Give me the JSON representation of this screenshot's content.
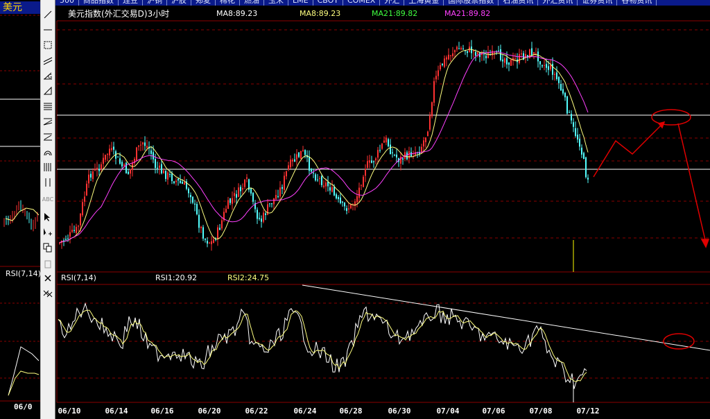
{
  "topnav": {
    "tabs": [
      "500",
      "商品指数",
      "连豆",
      "沪铜",
      "沪胶",
      "郑麦",
      "棉花",
      "燃油",
      "玉米",
      "LME",
      "CBOT",
      "COMEX",
      "外汇",
      "上海黄金",
      "国际股票指数",
      "石油资讯",
      "外汇资讯",
      "证券资讯",
      "谷物资讯"
    ]
  },
  "left_panel": {
    "title": "美元",
    "rsi_label": "RSI(7,14)",
    "date_label": "06/0"
  },
  "chart": {
    "title": "美元指数(外汇交易D)3小时",
    "ma8a": "MA8:89.23",
    "ma8b": "MA8:89.23",
    "ma21a": "MA21:89.82",
    "ma21b": "MA21:89.82",
    "colors": {
      "up": "#ff3232",
      "down": "#54ffff",
      "ma8": "#ffff80",
      "ma21": "#ff40ff",
      "grid": "#8b0000",
      "rsi1": "#ffffff",
      "rsi2": "#ffff80",
      "annotation": "#e00000"
    }
  },
  "rsi": {
    "label": "RSI(7,14)",
    "rsi1": "RSI1:20.92",
    "rsi2": "RSI2:24.75"
  },
  "xaxis": {
    "labels": [
      "06/10",
      "06/14",
      "06/16",
      "06/20",
      "06/22",
      "06/24",
      "06/28",
      "06/30",
      "07/04",
      "07/06",
      "07/08",
      "07/12"
    ]
  },
  "toolbar": {
    "tools": [
      "line-tool",
      "horizontal-line-tool",
      "rectangle-tool",
      "parallel-lines-tool",
      "fibonacci-tool",
      "triangle-tool",
      "gann-lines-tool",
      "gann-fan-tool",
      "fan-lines-tool",
      "arc-tool",
      "vertical-lines-tool",
      "cycle-lines-tool",
      "text-tool",
      "select-arrow-tool",
      "move-tool",
      "copy-tool",
      "paste-tool",
      "delete-tool",
      "delete-all-tool"
    ],
    "text_tool_label": "ABC"
  }
}
